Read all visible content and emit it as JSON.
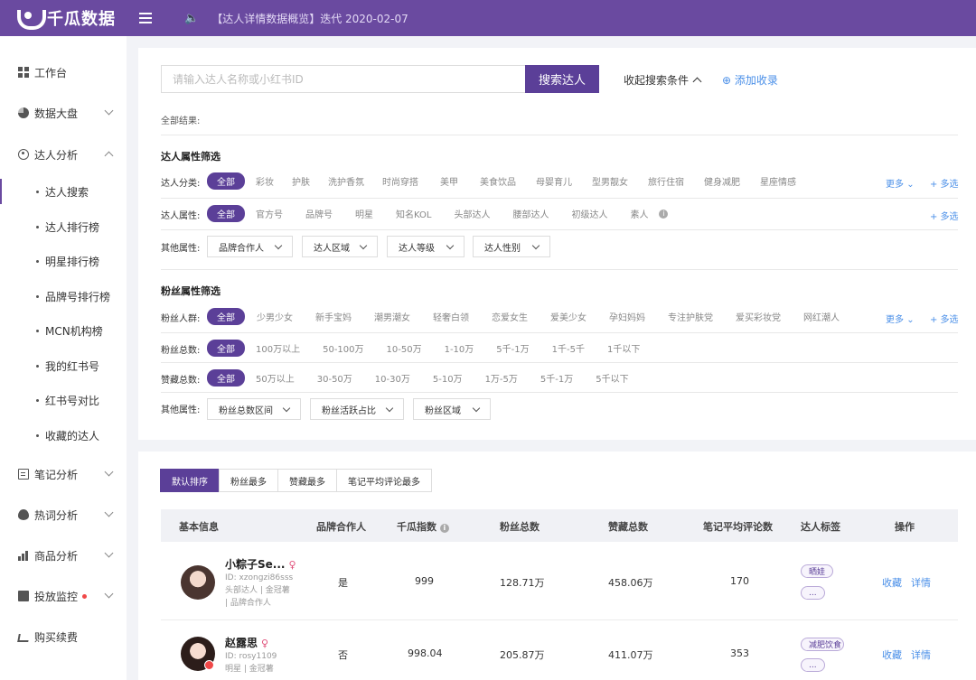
{
  "header": {
    "logo_text": "千瓜数据",
    "notice": "【达人详情数据概览】迭代  2020-02-07"
  },
  "sidebar": {
    "items": [
      {
        "label": "工作台",
        "icon": "grid-icon"
      },
      {
        "label": "数据大盘",
        "icon": "pie-chart-icon"
      },
      {
        "label": "达人分析",
        "icon": "user-icon"
      },
      {
        "label": "笔记分析",
        "icon": "document-icon"
      },
      {
        "label": "热词分析",
        "icon": "fire-icon"
      },
      {
        "label": "商品分析",
        "icon": "bar-chart-icon"
      },
      {
        "label": "投放监控",
        "icon": "monitor-icon"
      },
      {
        "label": "购买续费",
        "icon": "cart-icon"
      }
    ],
    "sub_items": [
      "达人搜索",
      "达人排行榜",
      "明星排行榜",
      "品牌号排行榜",
      "MCN机构榜",
      "我的红书号",
      "红书号对比",
      "收藏的达人"
    ]
  },
  "search": {
    "placeholder": "请输入达人名称或小红书ID",
    "button": "搜索达人",
    "collapse": "收起搜索条件",
    "add": "添加收录",
    "all_results": "全部结果:"
  },
  "kol_filters": {
    "title": "达人属性筛选",
    "category_label": "达人分类:",
    "categories": [
      "全部",
      "彩妆",
      "护肤",
      "洗护香氛",
      "时尚穿搭",
      "美甲",
      "美食饮品",
      "母婴育儿",
      "型男靓女",
      "旅行住宿",
      "健身减肥",
      "星座情感"
    ],
    "attr_label": "达人属性:",
    "attrs": [
      "全部",
      "官方号",
      "品牌号",
      "明星",
      "知名KOL",
      "头部达人",
      "腰部达人",
      "初级达人",
      "素人"
    ],
    "other_label": "其他属性:",
    "other_dropdowns": [
      "品牌合作人",
      "达人区域",
      "达人等级",
      "达人性别"
    ],
    "more": "更多",
    "multi": "+ 多选"
  },
  "fan_filters": {
    "title": "粉丝属性筛选",
    "crowd_label": "粉丝人群:",
    "crowds": [
      "全部",
      "少男少女",
      "新手宝妈",
      "潮男潮女",
      "轻奢白领",
      "恋爱女生",
      "爱美少女",
      "孕妇妈妈",
      "专注护肤党",
      "爱买彩妆党",
      "网红潮人"
    ],
    "total_label": "粉丝总数:",
    "totals": [
      "全部",
      "100万以上",
      "50-100万",
      "10-50万",
      "1-10万",
      "5千-1万",
      "1千-5千",
      "1千以下"
    ],
    "likes_label": "赞藏总数:",
    "likes": [
      "全部",
      "50万以上",
      "30-50万",
      "10-30万",
      "5-10万",
      "1万-5万",
      "5千-1万",
      "5千以下"
    ],
    "other_label": "其他属性:",
    "other_dropdowns": [
      "粉丝总数区间",
      "粉丝活跃占比",
      "粉丝区域"
    ]
  },
  "sort_tabs": [
    "默认排序",
    "粉丝最多",
    "赞藏最多",
    "笔记平均评论最多"
  ],
  "table": {
    "headers": [
      "基本信息",
      "品牌合作人",
      "千瓜指数",
      "粉丝总数",
      "赞藏总数",
      "笔记平均评论数",
      "达人标签",
      "操作"
    ],
    "rows": [
      {
        "name": "小粽子Se...",
        "id": "ID:  xzongzi86sss",
        "meta1": "头部达人 | 金冠薯",
        "meta2": "| 品牌合作人",
        "brand": "是",
        "index": "999",
        "fans": "128.71万",
        "likes": "458.06万",
        "comments": "170",
        "tag": "晒娃",
        "tag_more": "...",
        "collect": "收藏",
        "detail": "详情"
      },
      {
        "name": "赵露思",
        "id": "ID:  rosy1109",
        "meta1": "明星 | 金冠薯",
        "meta2": "",
        "brand": "否",
        "index": "998.04",
        "fans": "205.87万",
        "likes": "411.07万",
        "comments": "353",
        "tag": "减肥饮食",
        "tag_more": "...",
        "collect": "收藏",
        "detail": "详情"
      }
    ]
  },
  "colors": {
    "brand": "#6a4aa0",
    "primary_button": "#5b3f98",
    "link": "#4a8fe8"
  }
}
